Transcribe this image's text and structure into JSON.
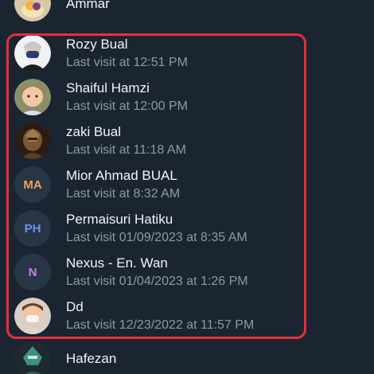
{
  "contacts": [
    {
      "name": "Ammar",
      "status": "",
      "avatar": "photo-dessert"
    },
    {
      "name": "Rozy Bual",
      "status": "Last visit at 12:51 PM",
      "avatar": "photo-masked-person"
    },
    {
      "name": "Shaiful Hamzi",
      "status": "Last visit at 12:00 PM",
      "avatar": "photo-child"
    },
    {
      "name": "zaki Bual",
      "status": "Last visit at 11:18 AM",
      "avatar": "photo-armored-figure"
    },
    {
      "name": "Mior Ahmad BUAL",
      "status": "Last visit at 8:32 AM",
      "initials": "MA",
      "color": "#f0a25a"
    },
    {
      "name": "Permaisuri Hatiku",
      "status": "Last visit 01/09/2023 at 8:35 AM",
      "initials": "PH",
      "color": "#6f8ff5"
    },
    {
      "name": "Nexus - En. Wan",
      "status": "Last visit 01/04/2023 at 1:26 PM",
      "initials": "N",
      "color": "#c77ee8"
    },
    {
      "name": "Dd",
      "status": "Last visit 12/23/2022 at 11:57 PM",
      "avatar": "photo-masked-person-2"
    },
    {
      "name": "Hafezan",
      "status": "",
      "avatar": "photo-armored-figure-2"
    }
  ],
  "colors": {
    "background": "#1b2532",
    "highlight_border": "#e5303a"
  }
}
